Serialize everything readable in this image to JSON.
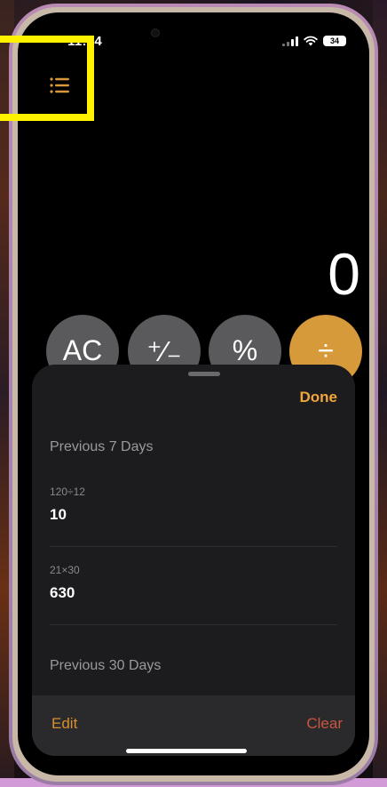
{
  "status_bar": {
    "time": "11:54",
    "battery": "34"
  },
  "calculator": {
    "display_value": "0",
    "keys": {
      "ac": "AC",
      "plus_minus": "⁺∕₋",
      "percent": "%",
      "divide": "÷"
    },
    "accent_color": "#d79a3a"
  },
  "history_sheet": {
    "done_label": "Done",
    "sections": [
      {
        "title": "Previous 7 Days",
        "items": [
          {
            "expression": "120÷12",
            "result": "10"
          },
          {
            "expression": "21×30",
            "result": "630"
          }
        ]
      },
      {
        "title": "Previous 30 Days",
        "items": []
      }
    ],
    "edit_label": "Edit",
    "clear_label": "Clear"
  },
  "icons": {
    "history": "list-icon",
    "wifi": "wifi-icon",
    "signal": "cellular-signal-icon",
    "battery": "battery-icon"
  },
  "highlight_color": "#fff200"
}
